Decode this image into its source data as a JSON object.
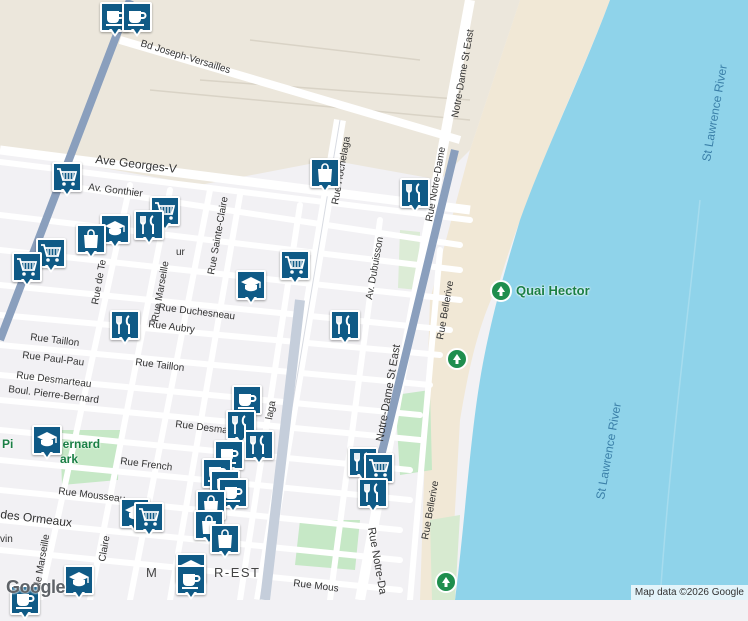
{
  "map": {
    "colors": {
      "water": "#8fd3ea",
      "land": "#f2f1f4",
      "industrial": "#ece7dc",
      "park": "#c6e8c6",
      "street": "#ffffff",
      "highway": "#8a9fbd",
      "marker": "#0f5a86"
    },
    "streets": {
      "joseph_versailles": "Bd Joseph-Versailles",
      "georges_v": "Ave Georges-V",
      "gonthier": "Av. Gonthier",
      "hochelaga": "Rue Hochelaga",
      "notre_dame_top": "Notre-Dame St East",
      "rue_notre_dame": "Rue Notre-Dame",
      "notre_dame_mid": "Notre-Dame St East",
      "notre_dame_bottom": "Rue Notre-Da",
      "dubuisson": "Av. Dubuisson",
      "sainte_claire": "Rue Sainte-Claire",
      "duchesneau": "Rue Duchesneau",
      "aubry": "Rue Aubry",
      "taillon_w": "Rue Taillon",
      "taillon_e": "Rue Taillon",
      "paul_pau": "Rue Paul-Pau",
      "desmarteau": "Rue Desmarteau",
      "desma": "Rue Desma",
      "pierre_bernard": "Boul. Pierre-Bernard",
      "french": "Rue French",
      "mousseau": "Rue Mousseau",
      "des_ormeaux": "des Ormeaux",
      "marseille": "Rue Marseille",
      "de_marseille": "de Marseille",
      "de_te": "Rue de Te",
      "bellerive_top": "Rue Bellerive",
      "bellerive_bottom": "Rue Bellerive",
      "mous": "Rue Mous",
      "claire": "Claire",
      "laga": "laga",
      "vin": "vin",
      "ur": "ur"
    },
    "water_labels": [
      "St Lawrence River",
      "St Lawrence River"
    ],
    "pois": {
      "quai_hector": "Quai Hector",
      "pierre_bernard_park_1": "Pi",
      "pierre_bernard_park_2": "e-Bernard",
      "pierre_bernard_park_3": "ark"
    },
    "district": "MERCIER-EST",
    "district_visible": "M",
    "district_visible_2": "R-EST"
  },
  "footer": {
    "logo": "Google",
    "attribution": "Map data ©2026 Google"
  }
}
